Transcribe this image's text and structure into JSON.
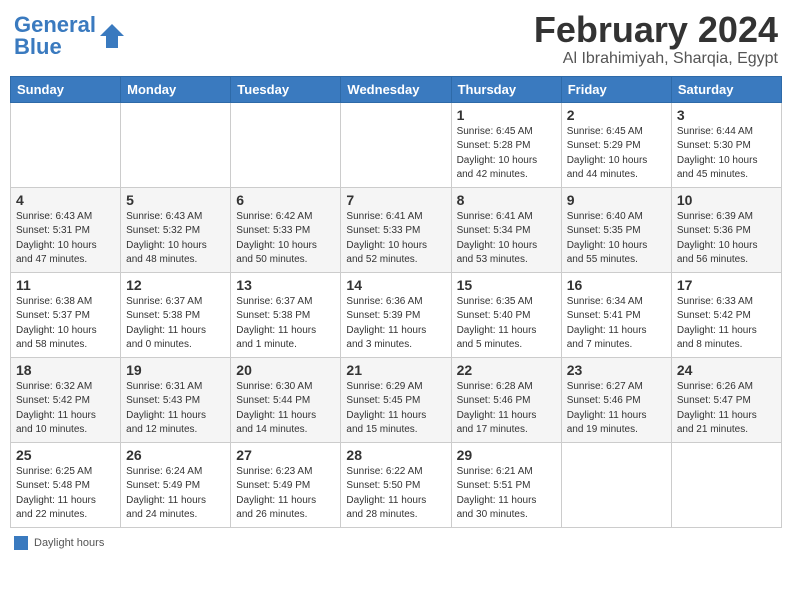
{
  "header": {
    "logo_general": "General",
    "logo_blue": "Blue",
    "month": "February 2024",
    "location": "Al Ibrahimiyah, Sharqia, Egypt"
  },
  "days_of_week": [
    "Sunday",
    "Monday",
    "Tuesday",
    "Wednesday",
    "Thursday",
    "Friday",
    "Saturday"
  ],
  "weeks": [
    [
      {
        "day": "",
        "info": ""
      },
      {
        "day": "",
        "info": ""
      },
      {
        "day": "",
        "info": ""
      },
      {
        "day": "",
        "info": ""
      },
      {
        "day": "1",
        "info": "Sunrise: 6:45 AM\nSunset: 5:28 PM\nDaylight: 10 hours\nand 42 minutes."
      },
      {
        "day": "2",
        "info": "Sunrise: 6:45 AM\nSunset: 5:29 PM\nDaylight: 10 hours\nand 44 minutes."
      },
      {
        "day": "3",
        "info": "Sunrise: 6:44 AM\nSunset: 5:30 PM\nDaylight: 10 hours\nand 45 minutes."
      }
    ],
    [
      {
        "day": "4",
        "info": "Sunrise: 6:43 AM\nSunset: 5:31 PM\nDaylight: 10 hours\nand 47 minutes."
      },
      {
        "day": "5",
        "info": "Sunrise: 6:43 AM\nSunset: 5:32 PM\nDaylight: 10 hours\nand 48 minutes."
      },
      {
        "day": "6",
        "info": "Sunrise: 6:42 AM\nSunset: 5:33 PM\nDaylight: 10 hours\nand 50 minutes."
      },
      {
        "day": "7",
        "info": "Sunrise: 6:41 AM\nSunset: 5:33 PM\nDaylight: 10 hours\nand 52 minutes."
      },
      {
        "day": "8",
        "info": "Sunrise: 6:41 AM\nSunset: 5:34 PM\nDaylight: 10 hours\nand 53 minutes."
      },
      {
        "day": "9",
        "info": "Sunrise: 6:40 AM\nSunset: 5:35 PM\nDaylight: 10 hours\nand 55 minutes."
      },
      {
        "day": "10",
        "info": "Sunrise: 6:39 AM\nSunset: 5:36 PM\nDaylight: 10 hours\nand 56 minutes."
      }
    ],
    [
      {
        "day": "11",
        "info": "Sunrise: 6:38 AM\nSunset: 5:37 PM\nDaylight: 10 hours\nand 58 minutes."
      },
      {
        "day": "12",
        "info": "Sunrise: 6:37 AM\nSunset: 5:38 PM\nDaylight: 11 hours\nand 0 minutes."
      },
      {
        "day": "13",
        "info": "Sunrise: 6:37 AM\nSunset: 5:38 PM\nDaylight: 11 hours\nand 1 minute."
      },
      {
        "day": "14",
        "info": "Sunrise: 6:36 AM\nSunset: 5:39 PM\nDaylight: 11 hours\nand 3 minutes."
      },
      {
        "day": "15",
        "info": "Sunrise: 6:35 AM\nSunset: 5:40 PM\nDaylight: 11 hours\nand 5 minutes."
      },
      {
        "day": "16",
        "info": "Sunrise: 6:34 AM\nSunset: 5:41 PM\nDaylight: 11 hours\nand 7 minutes."
      },
      {
        "day": "17",
        "info": "Sunrise: 6:33 AM\nSunset: 5:42 PM\nDaylight: 11 hours\nand 8 minutes."
      }
    ],
    [
      {
        "day": "18",
        "info": "Sunrise: 6:32 AM\nSunset: 5:42 PM\nDaylight: 11 hours\nand 10 minutes."
      },
      {
        "day": "19",
        "info": "Sunrise: 6:31 AM\nSunset: 5:43 PM\nDaylight: 11 hours\nand 12 minutes."
      },
      {
        "day": "20",
        "info": "Sunrise: 6:30 AM\nSunset: 5:44 PM\nDaylight: 11 hours\nand 14 minutes."
      },
      {
        "day": "21",
        "info": "Sunrise: 6:29 AM\nSunset: 5:45 PM\nDaylight: 11 hours\nand 15 minutes."
      },
      {
        "day": "22",
        "info": "Sunrise: 6:28 AM\nSunset: 5:46 PM\nDaylight: 11 hours\nand 17 minutes."
      },
      {
        "day": "23",
        "info": "Sunrise: 6:27 AM\nSunset: 5:46 PM\nDaylight: 11 hours\nand 19 minutes."
      },
      {
        "day": "24",
        "info": "Sunrise: 6:26 AM\nSunset: 5:47 PM\nDaylight: 11 hours\nand 21 minutes."
      }
    ],
    [
      {
        "day": "25",
        "info": "Sunrise: 6:25 AM\nSunset: 5:48 PM\nDaylight: 11 hours\nand 22 minutes."
      },
      {
        "day": "26",
        "info": "Sunrise: 6:24 AM\nSunset: 5:49 PM\nDaylight: 11 hours\nand 24 minutes."
      },
      {
        "day": "27",
        "info": "Sunrise: 6:23 AM\nSunset: 5:49 PM\nDaylight: 11 hours\nand 26 minutes."
      },
      {
        "day": "28",
        "info": "Sunrise: 6:22 AM\nSunset: 5:50 PM\nDaylight: 11 hours\nand 28 minutes."
      },
      {
        "day": "29",
        "info": "Sunrise: 6:21 AM\nSunset: 5:51 PM\nDaylight: 11 hours\nand 30 minutes."
      },
      {
        "day": "",
        "info": ""
      },
      {
        "day": "",
        "info": ""
      }
    ]
  ],
  "legend": {
    "label": "Daylight hours"
  }
}
